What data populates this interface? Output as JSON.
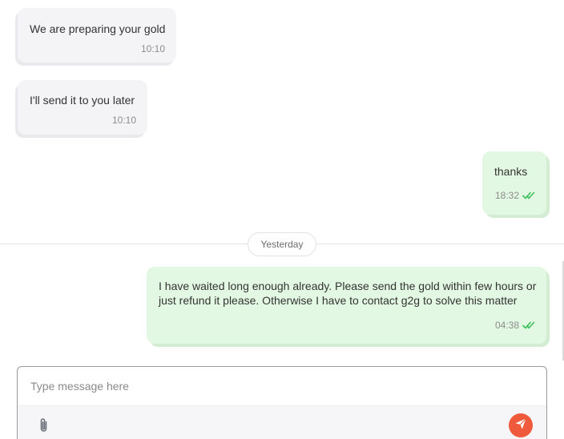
{
  "messages": [
    {
      "text": "We are preparing your gold",
      "time": "10:10"
    },
    {
      "text": "I'll send it to you later",
      "time": "10:10"
    },
    {
      "text": "thanks",
      "time": "18:32"
    },
    {
      "text": "I have waited long enough already. Please send the gold within few hours or just refund it please. Otherwise I have to contact g2g to solve this matter",
      "time": "04:38"
    }
  ],
  "date_divider": "Yesterday",
  "composer": {
    "placeholder": "Type message here"
  },
  "icons": {
    "attach": "paperclip-icon",
    "send": "paper-plane-icon",
    "read_receipt": "double-check-icon"
  },
  "colors": {
    "incoming_bubble": "#f4f4f6",
    "outgoing_bubble": "#e3f8e3",
    "read_check": "#3cbf5a",
    "send_button": "#f05a3c"
  }
}
